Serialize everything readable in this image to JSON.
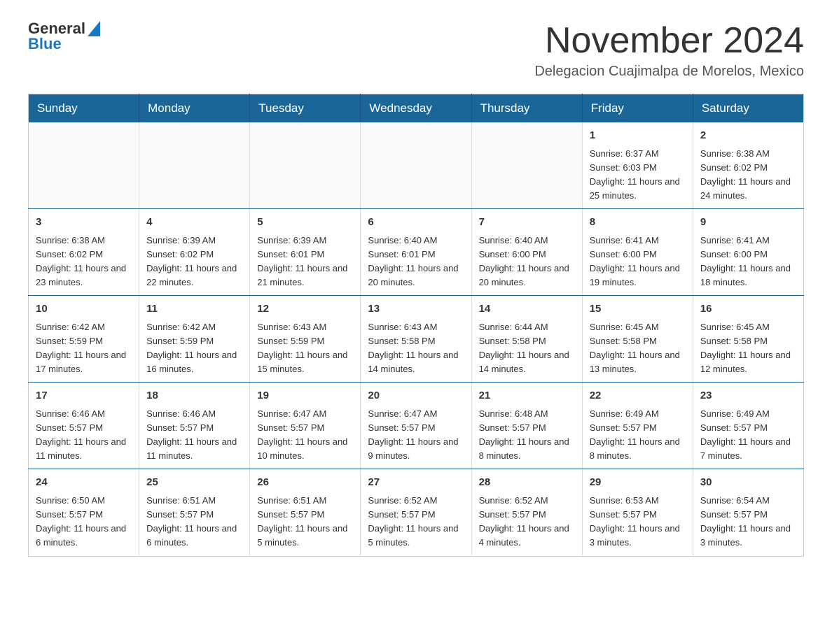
{
  "header": {
    "logo_general": "General",
    "logo_blue": "Blue",
    "month_title": "November 2024",
    "subtitle": "Delegacion Cuajimalpa de Morelos, Mexico"
  },
  "calendar": {
    "days_of_week": [
      "Sunday",
      "Monday",
      "Tuesday",
      "Wednesday",
      "Thursday",
      "Friday",
      "Saturday"
    ],
    "weeks": [
      [
        {
          "day": "",
          "info": ""
        },
        {
          "day": "",
          "info": ""
        },
        {
          "day": "",
          "info": ""
        },
        {
          "day": "",
          "info": ""
        },
        {
          "day": "",
          "info": ""
        },
        {
          "day": "1",
          "info": "Sunrise: 6:37 AM\nSunset: 6:03 PM\nDaylight: 11 hours and 25 minutes."
        },
        {
          "day": "2",
          "info": "Sunrise: 6:38 AM\nSunset: 6:02 PM\nDaylight: 11 hours and 24 minutes."
        }
      ],
      [
        {
          "day": "3",
          "info": "Sunrise: 6:38 AM\nSunset: 6:02 PM\nDaylight: 11 hours and 23 minutes."
        },
        {
          "day": "4",
          "info": "Sunrise: 6:39 AM\nSunset: 6:02 PM\nDaylight: 11 hours and 22 minutes."
        },
        {
          "day": "5",
          "info": "Sunrise: 6:39 AM\nSunset: 6:01 PM\nDaylight: 11 hours and 21 minutes."
        },
        {
          "day": "6",
          "info": "Sunrise: 6:40 AM\nSunset: 6:01 PM\nDaylight: 11 hours and 20 minutes."
        },
        {
          "day": "7",
          "info": "Sunrise: 6:40 AM\nSunset: 6:00 PM\nDaylight: 11 hours and 20 minutes."
        },
        {
          "day": "8",
          "info": "Sunrise: 6:41 AM\nSunset: 6:00 PM\nDaylight: 11 hours and 19 minutes."
        },
        {
          "day": "9",
          "info": "Sunrise: 6:41 AM\nSunset: 6:00 PM\nDaylight: 11 hours and 18 minutes."
        }
      ],
      [
        {
          "day": "10",
          "info": "Sunrise: 6:42 AM\nSunset: 5:59 PM\nDaylight: 11 hours and 17 minutes."
        },
        {
          "day": "11",
          "info": "Sunrise: 6:42 AM\nSunset: 5:59 PM\nDaylight: 11 hours and 16 minutes."
        },
        {
          "day": "12",
          "info": "Sunrise: 6:43 AM\nSunset: 5:59 PM\nDaylight: 11 hours and 15 minutes."
        },
        {
          "day": "13",
          "info": "Sunrise: 6:43 AM\nSunset: 5:58 PM\nDaylight: 11 hours and 14 minutes."
        },
        {
          "day": "14",
          "info": "Sunrise: 6:44 AM\nSunset: 5:58 PM\nDaylight: 11 hours and 14 minutes."
        },
        {
          "day": "15",
          "info": "Sunrise: 6:45 AM\nSunset: 5:58 PM\nDaylight: 11 hours and 13 minutes."
        },
        {
          "day": "16",
          "info": "Sunrise: 6:45 AM\nSunset: 5:58 PM\nDaylight: 11 hours and 12 minutes."
        }
      ],
      [
        {
          "day": "17",
          "info": "Sunrise: 6:46 AM\nSunset: 5:57 PM\nDaylight: 11 hours and 11 minutes."
        },
        {
          "day": "18",
          "info": "Sunrise: 6:46 AM\nSunset: 5:57 PM\nDaylight: 11 hours and 11 minutes."
        },
        {
          "day": "19",
          "info": "Sunrise: 6:47 AM\nSunset: 5:57 PM\nDaylight: 11 hours and 10 minutes."
        },
        {
          "day": "20",
          "info": "Sunrise: 6:47 AM\nSunset: 5:57 PM\nDaylight: 11 hours and 9 minutes."
        },
        {
          "day": "21",
          "info": "Sunrise: 6:48 AM\nSunset: 5:57 PM\nDaylight: 11 hours and 8 minutes."
        },
        {
          "day": "22",
          "info": "Sunrise: 6:49 AM\nSunset: 5:57 PM\nDaylight: 11 hours and 8 minutes."
        },
        {
          "day": "23",
          "info": "Sunrise: 6:49 AM\nSunset: 5:57 PM\nDaylight: 11 hours and 7 minutes."
        }
      ],
      [
        {
          "day": "24",
          "info": "Sunrise: 6:50 AM\nSunset: 5:57 PM\nDaylight: 11 hours and 6 minutes."
        },
        {
          "day": "25",
          "info": "Sunrise: 6:51 AM\nSunset: 5:57 PM\nDaylight: 11 hours and 6 minutes."
        },
        {
          "day": "26",
          "info": "Sunrise: 6:51 AM\nSunset: 5:57 PM\nDaylight: 11 hours and 5 minutes."
        },
        {
          "day": "27",
          "info": "Sunrise: 6:52 AM\nSunset: 5:57 PM\nDaylight: 11 hours and 5 minutes."
        },
        {
          "day": "28",
          "info": "Sunrise: 6:52 AM\nSunset: 5:57 PM\nDaylight: 11 hours and 4 minutes."
        },
        {
          "day": "29",
          "info": "Sunrise: 6:53 AM\nSunset: 5:57 PM\nDaylight: 11 hours and 3 minutes."
        },
        {
          "day": "30",
          "info": "Sunrise: 6:54 AM\nSunset: 5:57 PM\nDaylight: 11 hours and 3 minutes."
        }
      ]
    ]
  }
}
